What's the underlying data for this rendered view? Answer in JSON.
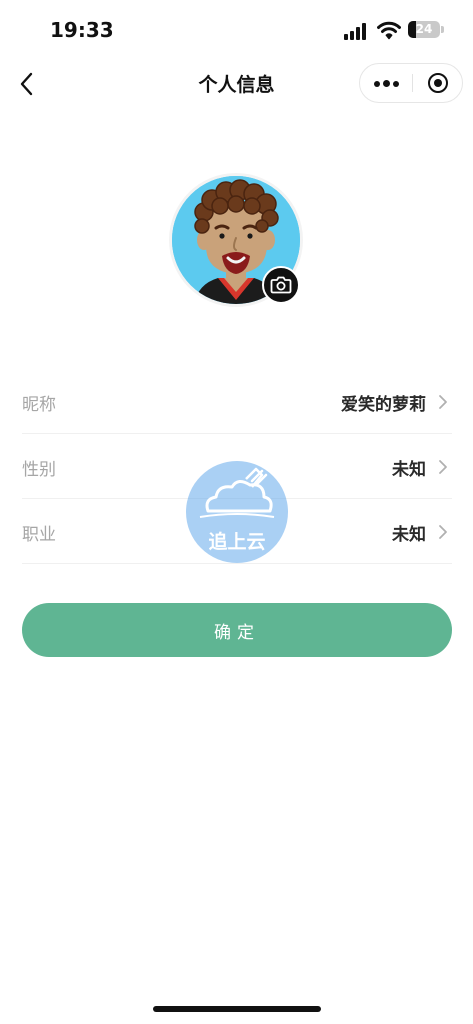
{
  "status_bar": {
    "time": "19:33",
    "battery": "24",
    "icons": [
      "signal-icon",
      "wifi-icon",
      "battery-icon"
    ]
  },
  "nav": {
    "title": "个人信息",
    "back_icon": "chevron-left-icon",
    "more_icon": "more-dots-icon",
    "close_icon": "target-circle-icon"
  },
  "avatar": {
    "camera_icon": "camera-icon"
  },
  "profile": {
    "rows": [
      {
        "label": "昵称",
        "value": "爱笑的萝莉"
      },
      {
        "label": "性别",
        "value": "未知"
      },
      {
        "label": "职业",
        "value": "未知"
      }
    ]
  },
  "confirm_button": "确定",
  "watermark": {
    "text": "追上云"
  },
  "colors": {
    "accent": "#5fb593",
    "avatar_bg": "#5ccaef",
    "watermark": "#64aaeb"
  }
}
